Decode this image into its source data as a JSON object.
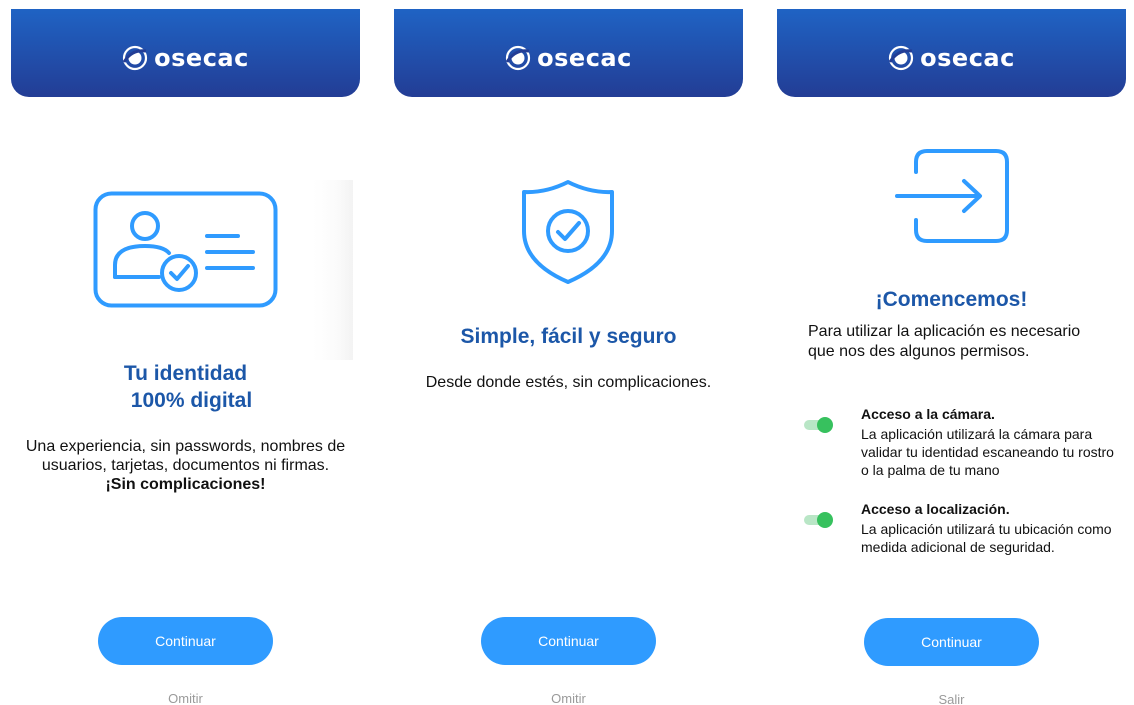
{
  "brand": {
    "name": "osecac"
  },
  "screens": [
    {
      "title_line1": "Tu identidad",
      "title_line2": "100% digital",
      "body": "Una experiencia, sin passwords, nombres de usuarios, tarjetas, documentos ni firmas.",
      "body_strong": "¡Sin complicaciones!",
      "primary_button": "Continuar",
      "secondary_link": "Omitir"
    },
    {
      "title": "Simple, fácil y seguro",
      "body": "Desde donde estés, sin complicaciones.",
      "primary_button": "Continuar",
      "secondary_link": "Omitir"
    },
    {
      "title": "¡Comencemos!",
      "body": "Para utilizar la aplicación es necesario que nos des algunos permisos.",
      "permissions": [
        {
          "title": "Acceso a la cámara.",
          "description": "La aplicación utilizará la cámara para validar tu identidad escaneando tu rostro o la palma de tu mano",
          "enabled": true
        },
        {
          "title": "Acceso a localización.",
          "description": "La aplicación utilizará tu ubicación como medida adicional de seguridad.",
          "enabled": true
        }
      ],
      "primary_button": "Continuar",
      "secondary_link": "Salir"
    }
  ],
  "colors": {
    "header_top": "#1f63c4",
    "header_bottom": "#233d95",
    "accent": "#2f9bff",
    "title": "#1c57a8",
    "toggle_on": "#37c15e"
  },
  "icons": [
    "osecac-logo-icon",
    "id-card-icon",
    "shield-check-icon",
    "login-arrow-icon"
  ]
}
